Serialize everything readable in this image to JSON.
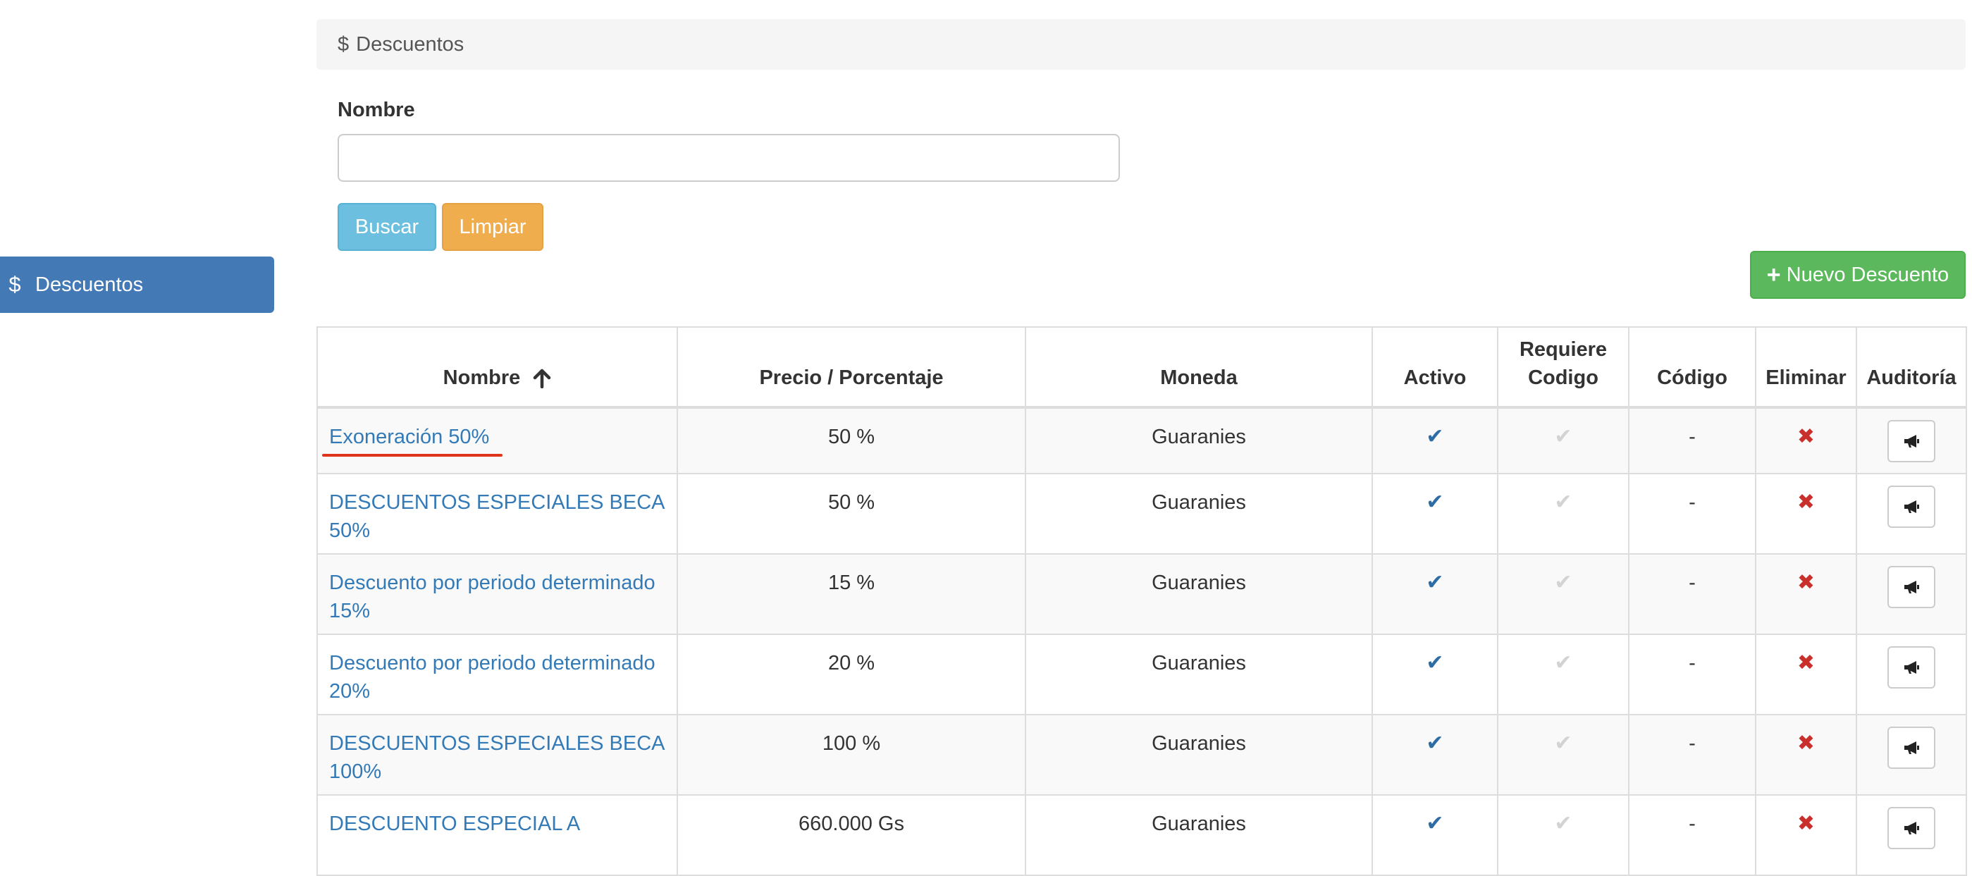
{
  "sidebar": {
    "items": [
      {
        "icon": "dollar-icon",
        "label": "Descuentos",
        "active": true
      }
    ]
  },
  "panel": {
    "title": "Descuentos",
    "icon": "dollar-icon"
  },
  "search_form": {
    "name_label": "Nombre",
    "name_value": "",
    "name_placeholder": "",
    "search_label": "Buscar",
    "clear_label": "Limpiar"
  },
  "new_button": {
    "label": "Nuevo Descuento",
    "icon": "plus-icon"
  },
  "table": {
    "headers": {
      "nombre": "Nombre",
      "precio": "Precio / Porcentaje",
      "moneda": "Moneda",
      "activo": "Activo",
      "requiere_line1": "Requiere",
      "requiere_line2": "Codigo",
      "codigo": "Código",
      "eliminar": "Eliminar",
      "auditoria": "Auditoría"
    },
    "sort_icon": "arrow-up-icon",
    "rows": [
      {
        "name": "Exoneración 50%",
        "price": "50 %",
        "currency": "Guaranies",
        "code": "-"
      },
      {
        "name": "DESCUENTOS ESPECIALES BECA 50%",
        "price": "50 %",
        "currency": "Guaranies",
        "code": "-"
      },
      {
        "name": "Descuento por periodo determinado 15%",
        "price": "15 %",
        "currency": "Guaranies",
        "code": "-"
      },
      {
        "name": "Descuento por periodo determinado 20%",
        "price": "20 %",
        "currency": "Guaranies",
        "code": "-"
      },
      {
        "name": "DESCUENTOS ESPECIALES BECA 100%",
        "price": "100 %",
        "currency": "Guaranies",
        "code": "-"
      },
      {
        "name": "DESCUENTO ESPECIAL A",
        "price": "660.000 Gs",
        "currency": "Guaranies",
        "code": "-"
      }
    ]
  },
  "colors": {
    "sidebar_active": "#437ab6",
    "link": "#337ab7",
    "search_button": "#6cbfde",
    "clear_button": "#f0ad4e",
    "new_button": "#5cb85c",
    "delete": "#c9302c",
    "underline_highlight": "#e0331c"
  }
}
